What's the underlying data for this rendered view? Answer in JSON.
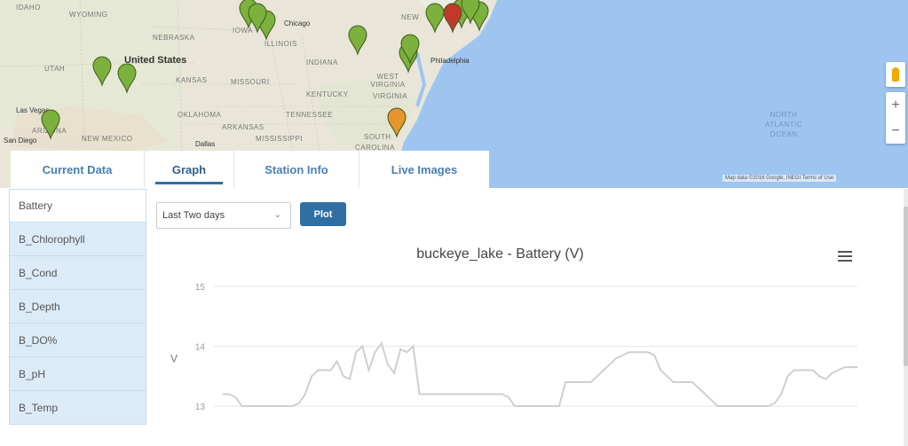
{
  "map": {
    "state_labels": [
      {
        "id": "idaho",
        "text": "IDAHO"
      },
      {
        "id": "wyoming",
        "text": "WYOMING"
      },
      {
        "id": "nebraska",
        "text": "NEBRASKA"
      },
      {
        "id": "iowa",
        "text": "IOWA"
      },
      {
        "id": "illinois",
        "text": "ILLINOIS"
      },
      {
        "id": "indiana",
        "text": "INDIANA"
      },
      {
        "id": "utah",
        "text": "UTAH"
      },
      {
        "id": "kansas",
        "text": "KANSAS"
      },
      {
        "id": "missouri",
        "text": "MISSOURI"
      },
      {
        "id": "west-virginia",
        "text": "WEST VIRGINIA"
      },
      {
        "id": "kentucky",
        "text": "KENTUCKY"
      },
      {
        "id": "virginia",
        "text": "VIRGINIA"
      },
      {
        "id": "oklahoma",
        "text": "OKLAHOMA"
      },
      {
        "id": "tennessee",
        "text": "TENNESSEE"
      },
      {
        "id": "arkansas",
        "text": "ARKANSAS"
      },
      {
        "id": "arizona",
        "text": "ARIZONA"
      },
      {
        "id": "new-mexico",
        "text": "NEW MEXICO"
      },
      {
        "id": "mississippi",
        "text": "MISSISSIPPI"
      },
      {
        "id": "carolina",
        "text": "CAROLINA"
      },
      {
        "id": "south",
        "text": "SOUTH"
      },
      {
        "id": "new",
        "text": "NEW"
      }
    ],
    "country_label": "United States",
    "city_labels": [
      {
        "id": "chicago",
        "text": "Chicago"
      },
      {
        "id": "philadelphia",
        "text": "Philadelphia"
      },
      {
        "id": "las-vegas",
        "text": "Las Vegas"
      },
      {
        "id": "san-diego",
        "text": "San Diego"
      },
      {
        "id": "dallas",
        "text": "Dallas"
      }
    ],
    "ocean_label": "North\nAtlantic\nOcean",
    "attribution": "Map data ©2016 Google, INEGI   Terms of Use",
    "zoom_in": "+",
    "zoom_out": "−",
    "marker_colors": {
      "green": "#7bb13c",
      "red": "#c0392b",
      "orange": "#e8952f"
    }
  },
  "tabs": [
    {
      "label": "Current Data",
      "active": false
    },
    {
      "label": "Graph",
      "active": true
    },
    {
      "label": "Station Info",
      "active": false
    },
    {
      "label": "Live Images",
      "active": false
    }
  ],
  "sidebar": {
    "items": [
      {
        "label": "Battery"
      },
      {
        "label": "B_Chlorophyll"
      },
      {
        "label": "B_Cond"
      },
      {
        "label": "B_Depth"
      },
      {
        "label": "B_DO%"
      },
      {
        "label": "B_pH"
      },
      {
        "label": "B_Temp"
      }
    ]
  },
  "controls": {
    "range_select": "Last Two days",
    "plot_button": "Plot"
  },
  "chart_data": {
    "type": "line",
    "title": "buckeye_lake - Battery (V)",
    "ylabel": "V",
    "yticks": [
      "15",
      "14",
      "13"
    ],
    "ylim": [
      13,
      15
    ],
    "color": "#cfcfcf",
    "grid": true,
    "x": [
      0,
      1,
      2,
      3,
      4,
      5,
      6,
      7,
      8,
      9,
      10,
      11,
      12,
      13,
      14,
      15,
      16,
      17,
      18,
      19,
      20,
      21,
      22,
      23,
      24,
      25,
      26,
      27,
      28,
      29,
      30,
      31,
      32,
      33,
      34,
      35,
      36,
      37,
      38,
      39,
      40,
      41,
      42,
      43,
      44,
      45,
      46,
      47,
      48,
      49,
      50,
      51,
      52,
      53,
      54,
      55,
      56,
      57,
      58,
      59,
      60,
      61,
      62,
      63,
      64,
      65,
      66,
      67,
      68,
      69,
      70,
      71,
      72,
      73,
      74,
      75,
      76,
      77,
      78,
      79,
      80,
      81,
      82,
      83,
      84,
      85,
      86,
      87,
      88,
      89,
      90,
      91,
      92,
      93,
      94,
      95,
      96,
      97,
      98,
      99,
      100
    ],
    "values": [
      13.2,
      13.2,
      13.15,
      13.0,
      13.0,
      13.0,
      13.0,
      13.0,
      13.0,
      13.0,
      13.0,
      13.0,
      13.05,
      13.2,
      13.5,
      13.6,
      13.6,
      13.6,
      13.75,
      13.5,
      13.45,
      13.9,
      14.0,
      13.6,
      13.9,
      14.05,
      13.7,
      13.55,
      13.95,
      13.9,
      14.0,
      13.2,
      13.2,
      13.2,
      13.2,
      13.2,
      13.2,
      13.2,
      13.2,
      13.2,
      13.2,
      13.2,
      13.2,
      13.2,
      13.2,
      13.15,
      13.0,
      13.0,
      13.0,
      13.0,
      13.0,
      13.0,
      13.0,
      13.0,
      13.4,
      13.4,
      13.4,
      13.4,
      13.4,
      13.5,
      13.6,
      13.7,
      13.8,
      13.85,
      13.9,
      13.9,
      13.9,
      13.9,
      13.85,
      13.6,
      13.5,
      13.4,
      13.4,
      13.4,
      13.4,
      13.3,
      13.2,
      13.1,
      13.0,
      13.0,
      13.0,
      13.0,
      13.0,
      13.0,
      13.0,
      13.0,
      13.0,
      13.05,
      13.2,
      13.5,
      13.6,
      13.6,
      13.6,
      13.6,
      13.5,
      13.45,
      13.55,
      13.6,
      13.65,
      13.65,
      13.65
    ]
  }
}
